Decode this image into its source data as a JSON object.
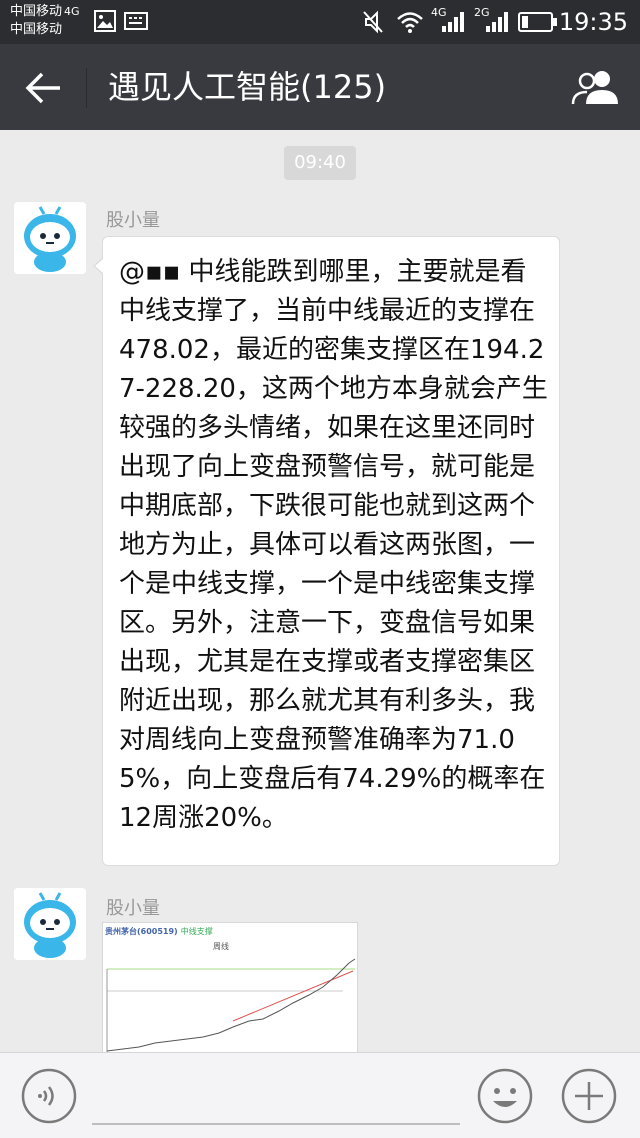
{
  "status_bar": {
    "carrier_line1": "中国移动",
    "carrier_line1_tag": "4G",
    "carrier_line2": "中国移动",
    "net1": "4G",
    "net2": "2G",
    "time": "19:35"
  },
  "header": {
    "title": "遇见人工智能(125)"
  },
  "chat": {
    "timestamp": "09:40",
    "messages": [
      {
        "sender": "股小量",
        "text": "@▪▪ 中线能跌到哪里，主要就是看中线支撑了，当前中线最近的支撑在478.02，最近的密集支撑区在194.27-228.20，这两个地方本身就会产生较强的多头情绪，如果在这里还同时出现了向上变盘预警信号，就可能是中期底部，下跌很可能也就到这两个地方为止，具体可以看这两张图，一个是中线支撑，一个是中线密集支撑区。另外，注意一下，变盘信号如果出现，尤其是在支撑或者支撑密集区附近出现，那么就尤其有利多头，我对周线向上变盘预警准确率为71.05%，向上变盘后有74.29%的概率在12周涨20%。"
      },
      {
        "sender": "股小量",
        "image": {
          "header": "贵州茅台(600519)",
          "header_tag": "中线支撑",
          "chart_title": "周线"
        }
      }
    ]
  },
  "colors": {
    "title_bar": "#393a3f",
    "status_bar": "#2b2d30",
    "chat_bg": "#ebebeb",
    "bubble": "#ffffff"
  },
  "icons": {
    "back": "arrow-left-icon",
    "members": "people-icon",
    "voice": "voice-icon",
    "emoji": "emoji-icon",
    "plus": "plus-icon"
  }
}
